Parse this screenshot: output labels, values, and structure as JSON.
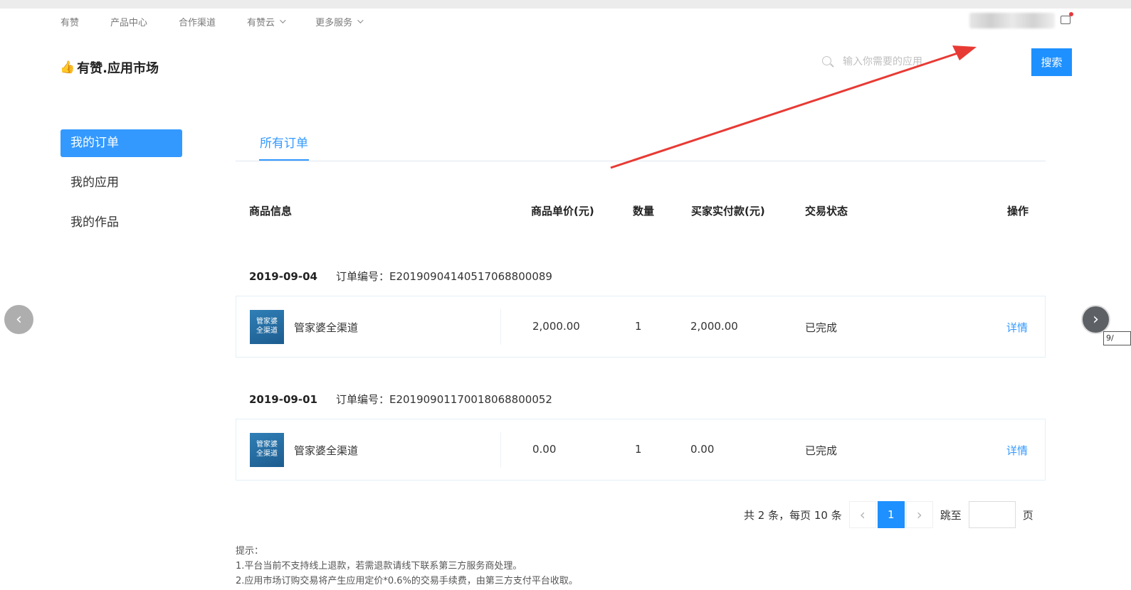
{
  "top_nav": {
    "items": [
      {
        "label": "有赞",
        "dropdown": false
      },
      {
        "label": "产品中心",
        "dropdown": false
      },
      {
        "label": "合作渠道",
        "dropdown": false
      },
      {
        "label": "有赞云",
        "dropdown": true
      },
      {
        "label": "更多服务",
        "dropdown": true
      }
    ]
  },
  "header": {
    "logo_icon": "thumbs-up-icon",
    "logo_text": "有赞.应用市场",
    "search_placeholder": "输入你需要的应用",
    "search_button": "搜索"
  },
  "sidebar": {
    "items": [
      {
        "label": "我的订单",
        "active": true
      },
      {
        "label": "我的应用",
        "active": false
      },
      {
        "label": "我的作品",
        "active": false
      }
    ]
  },
  "tabs": [
    {
      "label": "所有订单",
      "active": true
    }
  ],
  "table": {
    "columns": [
      "商品信息",
      "商品单价(元)",
      "数量",
      "买家实付款(元)",
      "交易状态",
      "操作"
    ]
  },
  "orders": [
    {
      "date": "2019-09-04",
      "order_no_label": "订单编号：",
      "order_no": "E20190904140517068800089",
      "icon_text_1": "管家婆",
      "icon_text_2": "全渠道",
      "product": "管家婆全渠道",
      "price": "2,000.00",
      "qty": "1",
      "paid": "2,000.00",
      "status": "已完成",
      "action": "详情"
    },
    {
      "date": "2019-09-01",
      "order_no_label": "订单编号：",
      "order_no": "E20190901170018068800052",
      "icon_text_1": "管家婆",
      "icon_text_2": "全渠道",
      "product": "管家婆全渠道",
      "price": "0.00",
      "qty": "1",
      "paid": "0.00",
      "status": "已完成",
      "action": "详情"
    }
  ],
  "pagination": {
    "summary": "共 2 条，每页 10 条",
    "prev": "‹",
    "current": "1",
    "next": "›",
    "jump_label": "跳至",
    "page_unit": "页"
  },
  "tips": {
    "title": "提示：",
    "line1": "1.平台当前不支持线上退款，若需退款请线下联系第三方服务商处理。",
    "line2": "2.应用市场订购交易将产生应用定价*0.6%的交易手续费，由第三方支付平台收取。"
  },
  "viewer": {
    "prev": "‹",
    "next": "›",
    "counter": "9/"
  },
  "colors": {
    "primary": "#1e90ff",
    "sidebar_active": "#3399ff",
    "annotation_arrow": "#e83a34"
  }
}
